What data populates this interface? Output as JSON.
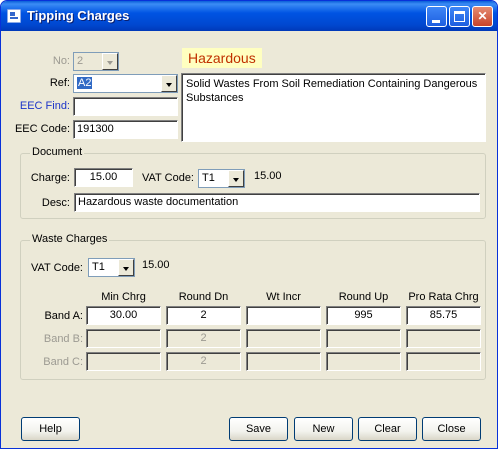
{
  "window": {
    "title": "Tipping Charges",
    "controls": {
      "minimize": "minimize-icon",
      "maximize": "maximize-icon",
      "close": "close-icon"
    }
  },
  "header": {
    "no_label": "No:",
    "no_value": "2",
    "ref_label": "Ref:",
    "ref_value": "A2",
    "eec_find_label": "EEC Find:",
    "eec_find_value": "",
    "eec_code_label": "EEC Code:",
    "eec_code_value": "191300",
    "status_badge": "Hazardous",
    "description": "Solid Wastes From Soil Remediation Containing Dangerous Substances"
  },
  "document": {
    "group_title": "Document",
    "charge_label": "Charge:",
    "charge_value": "15.00",
    "vat_code_label": "VAT Code:",
    "vat_code_value": "T1",
    "vat_rate": "15.00",
    "desc_label": "Desc:",
    "desc_value": "Hazardous waste documentation"
  },
  "waste_charges": {
    "group_title": "Waste Charges",
    "vat_code_label": "VAT Code:",
    "vat_code_value": "T1",
    "vat_rate": "15.00",
    "columns": [
      "Min Chrg",
      "Round Dn",
      "Wt Incr",
      "Round Up",
      "Pro Rata Chrg"
    ],
    "bands": [
      {
        "label": "Band A:",
        "values": [
          "30.00",
          "2",
          "",
          "995",
          "85.75"
        ],
        "enabled": true
      },
      {
        "label": "Band B:",
        "values": [
          "",
          "2",
          "",
          "",
          ""
        ],
        "enabled": false
      },
      {
        "label": "Band C:",
        "values": [
          "",
          "2",
          "",
          "",
          ""
        ],
        "enabled": false
      }
    ]
  },
  "buttons": {
    "help": "Help",
    "save": "Save",
    "new": "New",
    "clear": "Clear",
    "close": "Close"
  }
}
